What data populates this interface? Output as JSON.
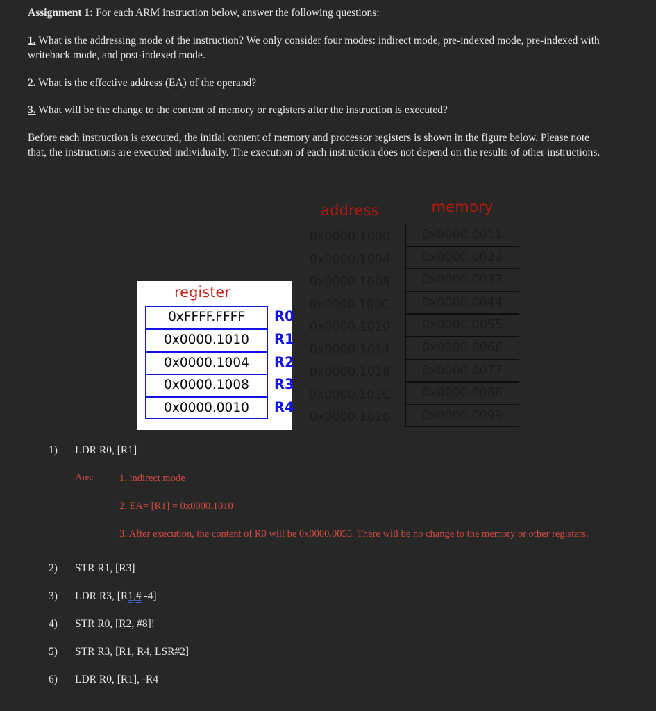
{
  "document": {
    "title_label": "Assignment 1:",
    "title_rest": " For each ARM instruction below, answer the following questions:",
    "q1_num": "1.",
    "q1_text": " What is the addressing mode of the instruction? We only consider four modes: indirect mode, pre-indexed mode, pre-indexed with writeback mode, and post-indexed mode.",
    "q2_num": "2.",
    "q2_text": " What is the effective address (EA) of the operand?",
    "q3_num": "3.",
    "q3_text": " What will be the change to the content of memory or registers after the instruction is executed?",
    "note": " Before each instruction is executed, the initial content of memory and processor registers is shown in the figure below. Please note that, the instructions are executed individually. The execution of each instruction does not depend on the results of other instructions."
  },
  "figure": {
    "address_header": "address",
    "memory_header": "memory",
    "register_header": "register",
    "addresses": [
      "0x0000.1000",
      "0x0000.1004",
      "0x0000.1008",
      "0x0000.100C",
      "0x0000.1010",
      "0x0000.1014",
      "0x0000.1018",
      "0x0000.101C",
      "0x0000.1020"
    ],
    "memory_values": [
      "0x0000.0011",
      "0x0000.0022",
      "0x0000.0033",
      "0x0000.0044",
      "0x0000.0055",
      "0x0000.0066",
      "0x0000.0077",
      "0x0000.0088",
      "0x0000.0099"
    ],
    "registers": [
      {
        "name": "R0",
        "value": "0xFFFF.FFFF"
      },
      {
        "name": "R1",
        "value": "0x0000.1010"
      },
      {
        "name": "R2",
        "value": "0x0000.1004"
      },
      {
        "name": "R3",
        "value": "0x0000.1008"
      },
      {
        "name": "R4",
        "value": "0x0000.0010"
      }
    ],
    "colors": {
      "header_red": "#b01a10",
      "register_red": "#c0271c",
      "register_blue": "#1414e6",
      "answer_red": "#d04a42",
      "page_background": "#272727"
    }
  },
  "instructions": [
    {
      "num": "1)",
      "text": "LDR R0, [R1]",
      "answer": {
        "label": "Ans:",
        "line1": "1. indirect mode",
        "line2": "2. EA= [R1] = 0x0000.1010",
        "line3": "3. After execution, the content of R0 will be 0x0000.0055. There will be no change to the memory or other registers."
      }
    },
    {
      "num": "2)",
      "text": "STR R1, [R3]"
    },
    {
      "num": "3)",
      "text_pre": "LDR R3, [R",
      "text_flagged": "1,#",
      "text_post": " -4]"
    },
    {
      "num": "4)",
      "text": "STR R0, [R2, #8]!"
    },
    {
      "num": "5)",
      "text": "STR R3, [R1, R4, LSR#2]"
    },
    {
      "num": "6)",
      "text": "LDR R0, [R1], -R4"
    }
  ]
}
